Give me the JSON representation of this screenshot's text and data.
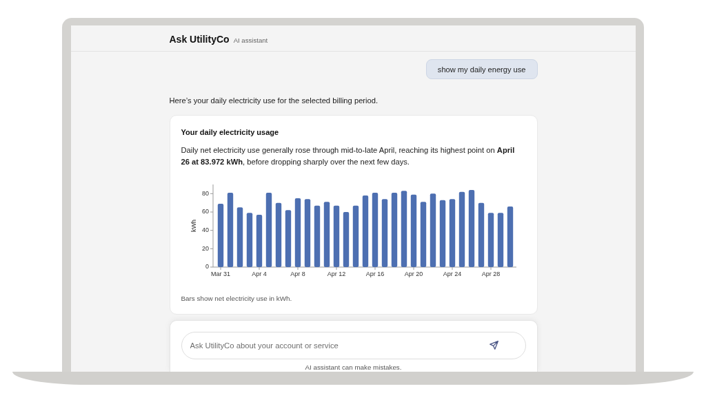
{
  "header": {
    "title": "Ask UtilityCo",
    "subtitle": "AI assistant"
  },
  "messages": [
    {
      "kind": "user",
      "text": "show my daily energy use"
    },
    {
      "kind": "assistant",
      "text": "Here’s your daily electricity use for the selected billing period."
    },
    {
      "kind": "card",
      "title": "Your daily electricity usage",
      "summary": "Daily net electricity use generally rose through mid-to-late April, reaching its highest point on **April 26 at 83.972 kWh**, before dropping sharply over the next few days.",
      "chart_data": {
        "type": "bar",
        "ylabel": "kWh",
        "categories": [
          "Mar 31",
          null,
          null,
          null,
          "Apr 4",
          null,
          null,
          null,
          "Apr 8",
          null,
          null,
          null,
          "Apr 12",
          null,
          null,
          null,
          "Apr 16",
          null,
          null,
          null,
          "Apr 20",
          null,
          null,
          null,
          "Apr 24",
          null,
          null,
          null,
          "Apr 28",
          null,
          null
        ],
        "values": [
          69,
          81,
          65,
          59,
          57,
          81,
          70,
          62,
          75,
          74,
          67,
          71,
          67,
          60,
          67,
          78,
          81,
          74,
          81,
          83,
          79,
          71,
          80,
          73,
          74,
          82,
          84,
          70,
          59,
          59,
          66
        ],
        "ylim": [
          0,
          90
        ],
        "yticks": [
          0,
          20,
          40,
          60,
          80
        ]
      },
      "caption": "Bars show net electricity use in kWh."
    }
  ],
  "composer": {
    "placeholder": "Ask UtilityCo about your account or service",
    "disclaimer": "AI assistant can make mistakes."
  }
}
